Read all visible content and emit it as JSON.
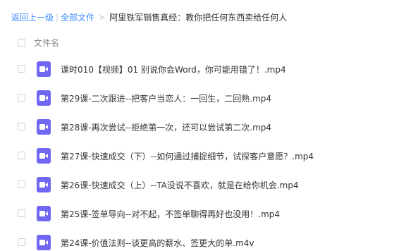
{
  "breadcrumb": {
    "back_label": "返回上一级",
    "separator": "|",
    "all_files_label": "全部文件",
    "arrow": ">",
    "current_folder": "阿里铁军销售真经：教你把任何东西卖给任何人"
  },
  "list_header": {
    "column_name": "文件名"
  },
  "files": [
    {
      "name": "课时010【视频】01 别说你会Word，你可能用错了！.mp4",
      "icon": "video-file-icon"
    },
    {
      "name": "第29课-二次跟进--把客户当恋人：一回生，二回熟.mp4",
      "icon": "video-file-icon"
    },
    {
      "name": "第28课-再次尝试--拒绝第一次，还可以尝试第二次.mp4",
      "icon": "video-file-icon"
    },
    {
      "name": "第27课-快速成交（下）--如何通过捕捉细节，试探客户意愿？.mp4",
      "icon": "video-file-icon"
    },
    {
      "name": "第26课-快速成交（上）--TA没说不喜欢，就是在给你机会.mp4",
      "icon": "video-file-icon"
    },
    {
      "name": "第25课-签单导向--对不起，不签单聊得再好也没用！.mp4",
      "icon": "video-file-icon"
    },
    {
      "name": "第24课-价值法则--谈更高的薪水、签更大的单.m4v",
      "icon": "video-file-icon"
    }
  ],
  "colors": {
    "link": "#3b8cff",
    "video_icon": "#7068f2",
    "text": "#333333"
  }
}
